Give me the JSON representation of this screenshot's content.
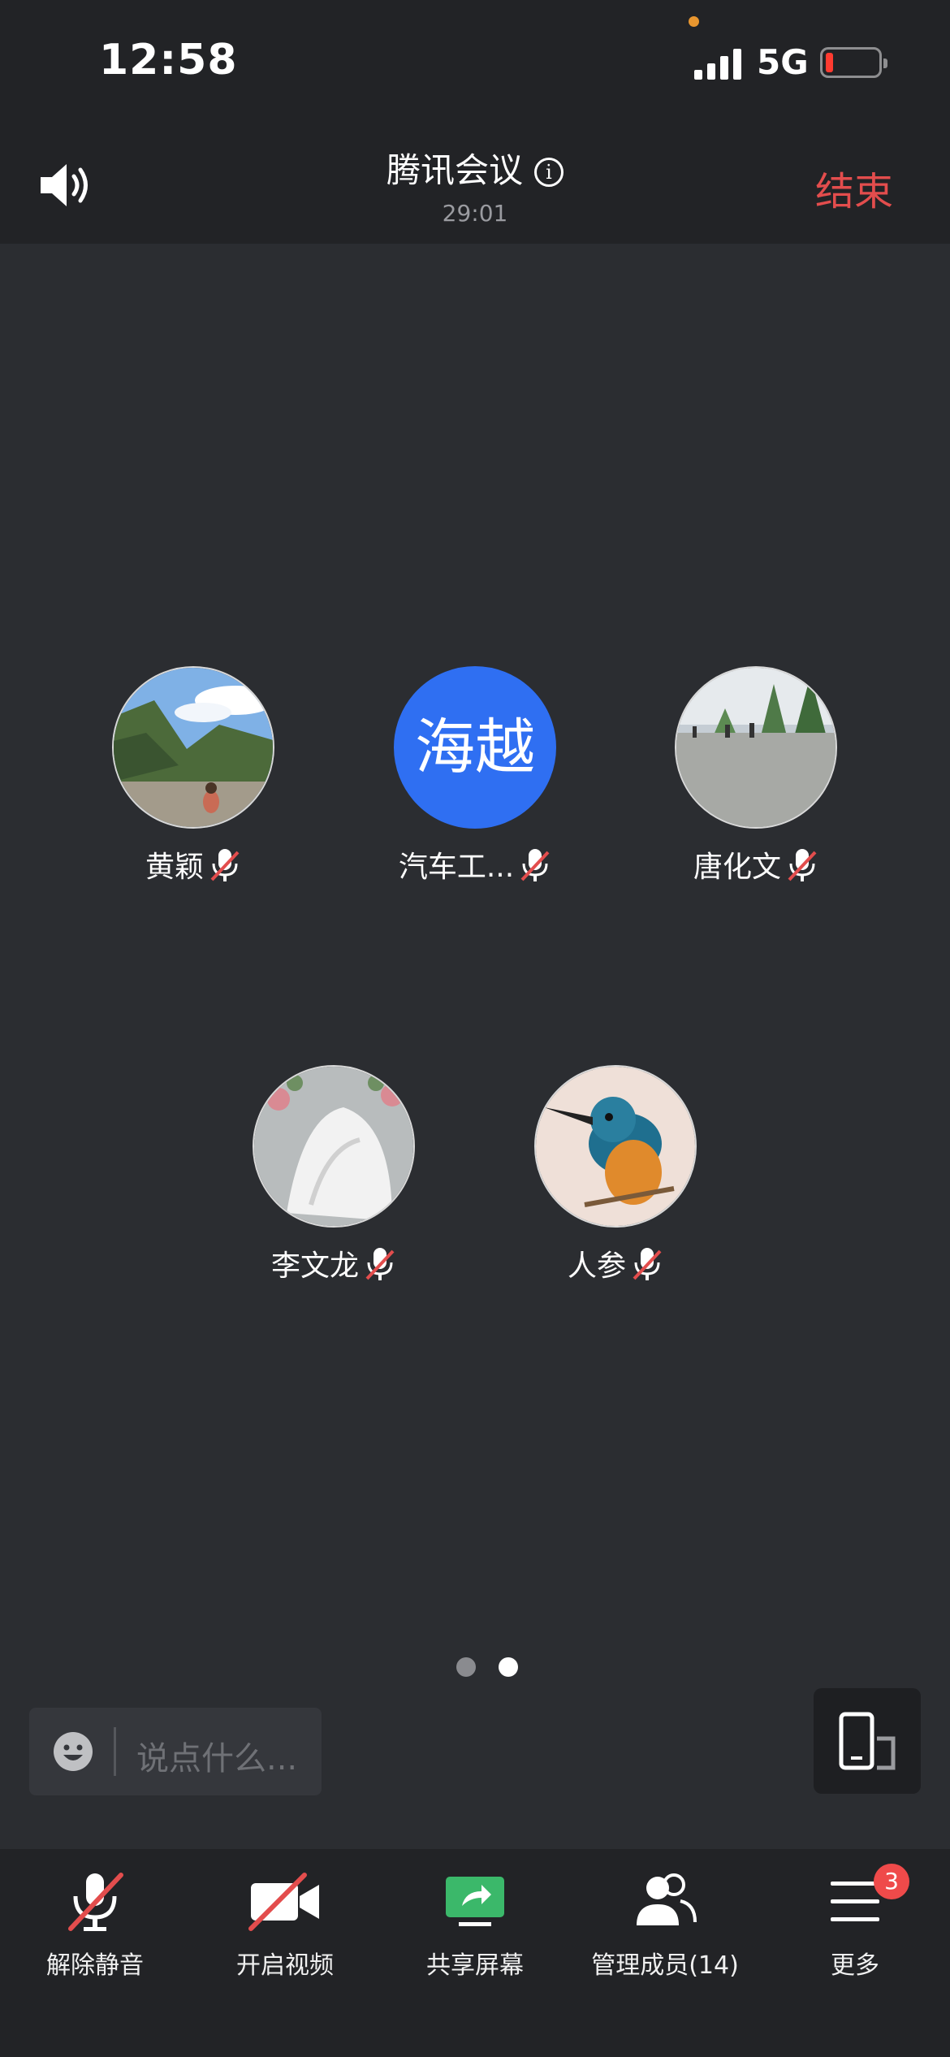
{
  "status_bar": {
    "time": "12:58",
    "network": "5G"
  },
  "header": {
    "title": "腾讯会议",
    "duration": "29:01",
    "end_label": "结束"
  },
  "participants": [
    {
      "name": "黄颖",
      "avatar": "mountain-river-photo",
      "muted": true
    },
    {
      "name": "汽车工...",
      "avatar_text": "海越",
      "muted": true
    },
    {
      "name": "唐化文",
      "avatar": "road-trees-photo",
      "muted": true
    },
    {
      "name": "李文龙",
      "avatar": "wedding-flowers-photo",
      "muted": true
    },
    {
      "name": "人参",
      "avatar": "kingfisher-bird-photo",
      "muted": true
    }
  ],
  "pager": {
    "pages": 2,
    "current": 2
  },
  "chat": {
    "placeholder": "说点什么..."
  },
  "toolbar": {
    "unmute_label": "解除静音",
    "video_label": "开启视频",
    "share_label": "共享屏幕",
    "members_label": "管理成员(14)",
    "more_label": "更多",
    "more_badge": "3"
  },
  "colors": {
    "accent_blue": "#2f6ff2",
    "end_red": "#e34d4d",
    "share_green": "#3bb86a",
    "badge_red": "#ef4a4a"
  }
}
